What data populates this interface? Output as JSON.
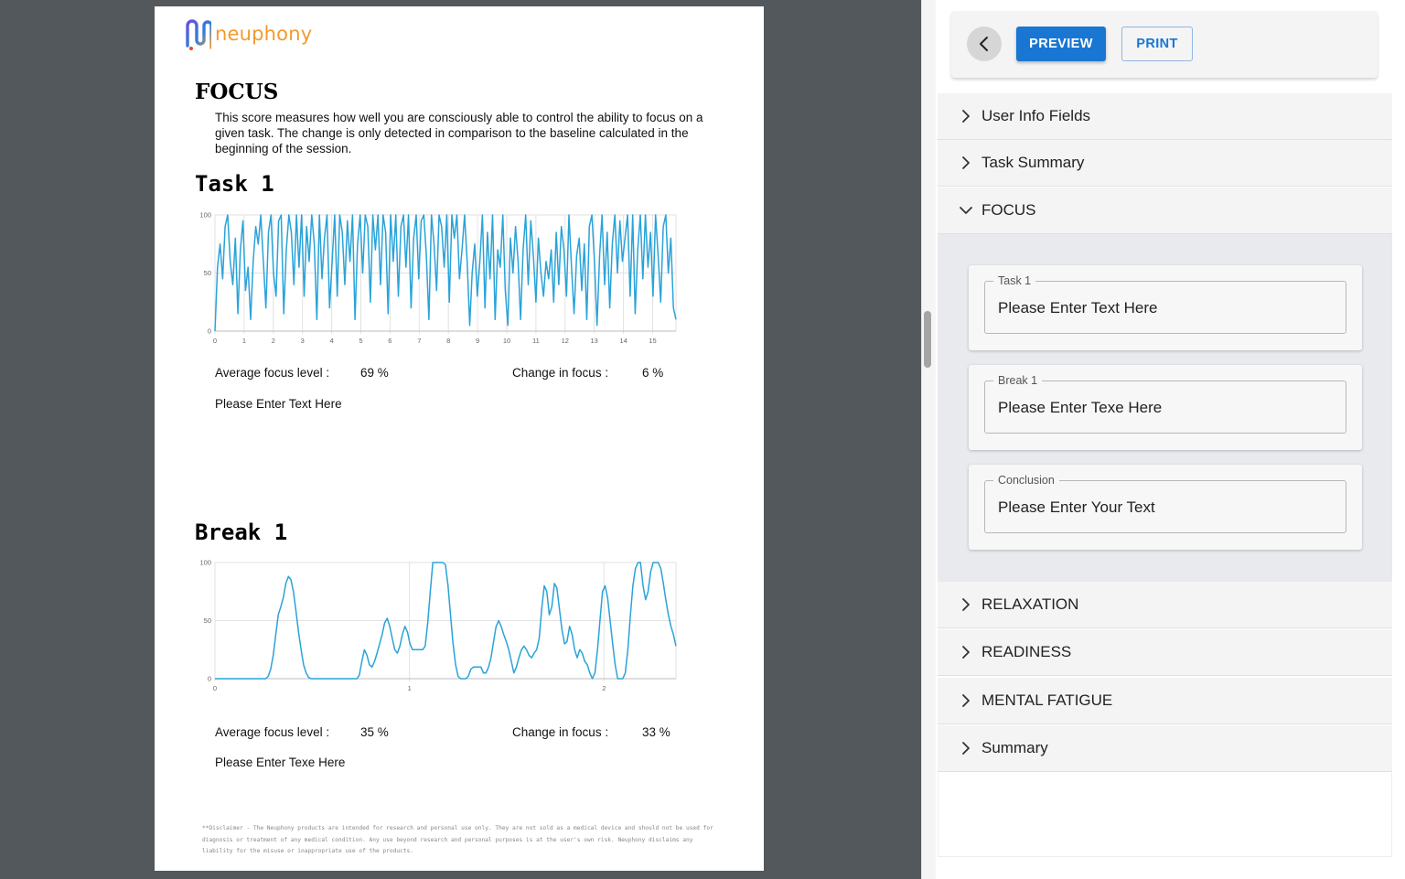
{
  "report": {
    "logo_text": "neuphony",
    "section_title": "FOCUS",
    "section_description": "This score measures how well you are consciously able to control the ability to focus on a given task. The change is only detected in comparison to the baseline calculated in the beginning of the session.",
    "task": {
      "title": "Task 1",
      "avg_label": "Average focus level :",
      "avg_value": "69 %",
      "change_label": "Change in focus :",
      "change_value": "6 %",
      "note": "Please Enter Text Here"
    },
    "break": {
      "title": "Break 1",
      "avg_label": "Average focus level :",
      "avg_value": "35 %",
      "change_label": "Change in focus :",
      "change_value": "33 %",
      "note": "Please Enter Texe Here"
    },
    "disclaimer": "**Disclaimer - The Neuphony products are intended for research and personal use only. They are not sold as a medical device and should not be used for diagnosis or treatment of any medical condition. Any use beyond research and personal purposes is at the user's own risk. Neuphony disclaims any liability for the misuse or inappropriate use of the products."
  },
  "chart_data": [
    {
      "type": "line",
      "title": "",
      "xlabel": "",
      "ylabel": "",
      "xlim": [
        0,
        15.8
      ],
      "ylim": [
        0,
        100
      ],
      "x_ticks": [
        "0",
        "1",
        "2",
        "3",
        "4",
        "5",
        "6",
        "7",
        "8",
        "9",
        "10",
        "11",
        "12",
        "13",
        "14",
        "15"
      ],
      "y_ticks": [
        "0",
        "50",
        "100"
      ],
      "grid": true,
      "color": "#2aa3d8",
      "series": [
        {
          "values": [
            0,
            55,
            75,
            45,
            90,
            100,
            60,
            40,
            80,
            15,
            70,
            95,
            35,
            55,
            10,
            60,
            90,
            75,
            100,
            60,
            20,
            85,
            100,
            50,
            30,
            95,
            100,
            15,
            70,
            100,
            85,
            40,
            100,
            55,
            100,
            30,
            90,
            60,
            100,
            75,
            10,
            100,
            45,
            80,
            100,
            20,
            60,
            100,
            30,
            100,
            85,
            40,
            95,
            60,
            100,
            10,
            75,
            100,
            50,
            100,
            90,
            25,
            100,
            70,
            100,
            40,
            100,
            85,
            15,
            100,
            60,
            100,
            30,
            90,
            100,
            55,
            100,
            20,
            80,
            100,
            45,
            95,
            100,
            65,
            10,
            100,
            75,
            35,
            100,
            90,
            55,
            100,
            25,
            100,
            80,
            100,
            45,
            70,
            100,
            60,
            5,
            50,
            75,
            30,
            60,
            100,
            20,
            85,
            45,
            100,
            10,
            70,
            55,
            100,
            35,
            5,
            80,
            50,
            90,
            60,
            10,
            70,
            100,
            40,
            95,
            65,
            25,
            80,
            50,
            30,
            60,
            45,
            70,
            25,
            85,
            40,
            90,
            70,
            30,
            100,
            55,
            15,
            65,
            80,
            35,
            75,
            10,
            90,
            100,
            60,
            5,
            65,
            100,
            40,
            85,
            20,
            75,
            100,
            50,
            95,
            60,
            80,
            100,
            30,
            100,
            15,
            70,
            100,
            45,
            100,
            55,
            85,
            30,
            100,
            65,
            25,
            90,
            100,
            50,
            80,
            20,
            10
          ]
        }
      ]
    },
    {
      "type": "line",
      "title": "",
      "xlabel": "",
      "ylabel": "",
      "xlim": [
        0,
        2.37
      ],
      "ylim": [
        0,
        100
      ],
      "x_ticks": [
        "0",
        "1",
        "2"
      ],
      "y_ticks": [
        "0",
        "50",
        "100"
      ],
      "grid": true,
      "color": "#2aa3d8",
      "series": [
        {
          "values": [
            0,
            0,
            0,
            0,
            0,
            0,
            0,
            0,
            0,
            0,
            0,
            0,
            0,
            0,
            0,
            0,
            0,
            0,
            0,
            0,
            0,
            2,
            8,
            20,
            38,
            55,
            62,
            70,
            82,
            88,
            85,
            75,
            58,
            40,
            25,
            12,
            5,
            1,
            0,
            0,
            0,
            0,
            0,
            0,
            0,
            0,
            0,
            0,
            0,
            0,
            0,
            0,
            0,
            0,
            0,
            0,
            0,
            3,
            15,
            25,
            20,
            12,
            10,
            15,
            22,
            30,
            38,
            48,
            52,
            45,
            35,
            25,
            22,
            28,
            38,
            45,
            40,
            30,
            25,
            25,
            25,
            25,
            25,
            28,
            48,
            75,
            100,
            100,
            100,
            100,
            100,
            98,
            80,
            55,
            30,
            12,
            2,
            0,
            0,
            0,
            2,
            8,
            10,
            10,
            10,
            10,
            5,
            5,
            10,
            18,
            32,
            45,
            50,
            45,
            38,
            32,
            25,
            15,
            5,
            10,
            18,
            25,
            28,
            25,
            20,
            18,
            22,
            25,
            35,
            60,
            80,
            75,
            55,
            62,
            82,
            78,
            60,
            42,
            30,
            32,
            45,
            38,
            25,
            18,
            25,
            22,
            15,
            12,
            5,
            0,
            5,
            25,
            50,
            75,
            80,
            70,
            50,
            30,
            12,
            0,
            0,
            0,
            5,
            25,
            55,
            80,
            95,
            100,
            100,
            80,
            68,
            75,
            92,
            100,
            100,
            100,
            95,
            82,
            68,
            55,
            45,
            38,
            28
          ]
        }
      ]
    }
  ],
  "panel": {
    "toolbar": {
      "back_icon": "chevron-left-icon",
      "preview_label": "PREVIEW",
      "print_label": "PRINT"
    },
    "sections": [
      {
        "label": "User Info Fields",
        "expanded": false
      },
      {
        "label": "Task Summary",
        "expanded": false
      },
      {
        "label": "FOCUS",
        "expanded": true
      },
      {
        "label": "RELAXATION",
        "expanded": false
      },
      {
        "label": "READINESS",
        "expanded": false
      },
      {
        "label": "MENTAL FATIGUE",
        "expanded": false
      },
      {
        "label": "Summary",
        "expanded": false
      }
    ],
    "focus_fields": [
      {
        "legend": "Task 1",
        "value": "Please Enter Text Here"
      },
      {
        "legend": "Break 1",
        "value": "Please Enter Texe Here"
      },
      {
        "legend": "Conclusion",
        "value": "Please Enter Your Text"
      }
    ]
  },
  "colors": {
    "accent": "#1976d2",
    "chart_line": "#2aa3d8",
    "logo_orange": "#f39a2d",
    "backdrop": "#53585c"
  }
}
